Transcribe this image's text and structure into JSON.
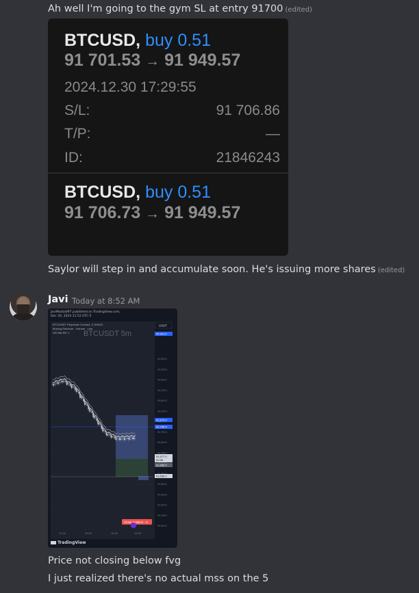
{
  "messages": {
    "m1": {
      "text": "Ah well I'm going to the gym SL at entry 91700",
      "edited": "(edited)"
    },
    "m2": {
      "text": "Saylor will step in and accumulate soon. He's issuing more shares",
      "edited": "(edited)"
    },
    "m3": {
      "text": "Price not closing below fvg"
    },
    "m4": {
      "text": "I just realized there's no actual mss on the 5"
    }
  },
  "trade": {
    "order1": {
      "symbol": "BTCUSD,",
      "side": "buy 0.51",
      "open_price": "91 701.53",
      "arrow": "→",
      "close_price": "91 949.57",
      "datetime": "2024.12.30 17:29:55",
      "sl_label": "S/L:",
      "sl_value": "91 706.86",
      "tp_label": "T/P:",
      "tp_value": "—",
      "id_label": "ID:",
      "id_value": "21846243"
    },
    "order2": {
      "symbol": "BTCUSD,",
      "side": "buy 0.51",
      "open_price": "91 706.73",
      "arrow": "→",
      "close_price": "91 949.57"
    }
  },
  "author": {
    "username": "Javi",
    "timestamp": "Today at 8:52 AM"
  },
  "chart": {
    "header_line1": "JaviMoota097 published on TradingView.com,",
    "header_line2": "Dec 30, 2024 11:52 UTC-5",
    "legend_line1": "BTC/USDT Perpetual Contract, 5, BINGX",
    "legend_line2": "Moving Structure · Volume · Line",
    "legend_line3": "DRI Blk RR: 1",
    "watermark": "BTCUSDT 5m",
    "quote_currency": "USDT",
    "brand": "TradingView",
    "x_ticks": [
      "21:30",
      "09:00",
      "10:30",
      "12:00"
    ],
    "y_ticks": [
      "94,500.0",
      "94,250.0",
      "94,000.0",
      "93,750.0",
      "93,500.0",
      "93,250.0",
      "93,000.0",
      "92,750.0",
      "92,500.0",
      "92,250.0",
      "92,000.0",
      "91,750.0",
      "91,500.0",
      "91,250.0",
      "91,000.0",
      "90,750.0",
      "90,500.0"
    ],
    "tags": {
      "current_price": "91,977.0",
      "current_time": "02:38",
      "low_box": "91,955.0",
      "entry": "91,566.0",
      "fvg_top": "92,672.0",
      "fvg_bottom": "92,755.9",
      "top_price": "94,501.0"
    },
    "close_label": "Close position · 2",
    "colors": {
      "background": "#131722",
      "candle": "#d1d4dc",
      "ma1": "#e0e0e0",
      "ma2": "#8a8e99",
      "fvg_box": "#3c4c7f",
      "green_box": "#2f4637",
      "accent_blue": "#2962ff",
      "sell_red": "#ef5350"
    }
  },
  "chart_data": {
    "type": "line",
    "x": [
      "21:30",
      "09:00",
      "10:30",
      "12:00"
    ],
    "ylim": [
      90500,
      94500
    ],
    "series": [
      {
        "values": [
          93850,
          93100,
          92000,
          91960
        ]
      }
    ]
  }
}
